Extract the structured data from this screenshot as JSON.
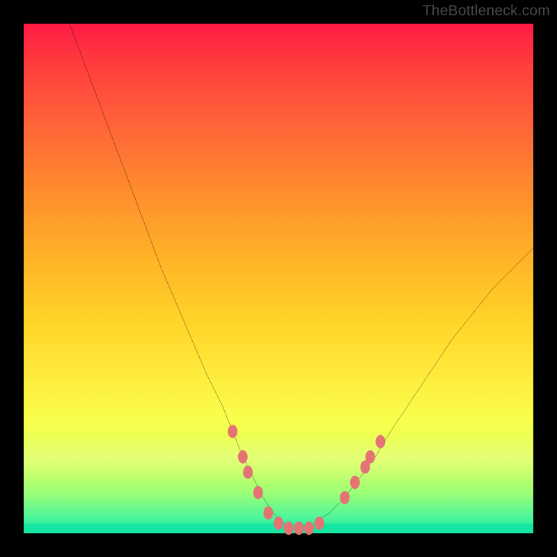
{
  "watermark": "TheBottleneck.com",
  "colors": {
    "frame": "#000000",
    "curve": "#000000",
    "marker": "#e57373",
    "gradient_top": "#ff1a44",
    "gradient_bottom": "#15e6a3"
  },
  "chart_data": {
    "type": "line",
    "title": "",
    "xlabel": "",
    "ylabel": "",
    "xlim": [
      0,
      100
    ],
    "ylim": [
      0,
      100
    ],
    "series": [
      {
        "name": "bottleneck-curve",
        "x": [
          9,
          12,
          15,
          18,
          21,
          24,
          27,
          30,
          33,
          36,
          39,
          41,
          43,
          45,
          47,
          49,
          51,
          53,
          55,
          57,
          60,
          63,
          66,
          69,
          72,
          76,
          80,
          84,
          88,
          92,
          96,
          100
        ],
        "y": [
          100,
          92,
          84,
          76,
          68,
          60,
          52,
          45,
          38,
          31,
          25,
          20,
          15,
          11,
          7,
          4,
          2,
          1,
          1,
          2,
          4,
          7,
          11,
          15,
          20,
          26,
          32,
          38,
          43,
          48,
          52,
          56
        ]
      }
    ],
    "markers": {
      "name": "highlight-points",
      "points": [
        {
          "x": 41,
          "y": 20
        },
        {
          "x": 43,
          "y": 15
        },
        {
          "x": 44,
          "y": 12
        },
        {
          "x": 46,
          "y": 8
        },
        {
          "x": 48,
          "y": 4
        },
        {
          "x": 50,
          "y": 2
        },
        {
          "x": 52,
          "y": 1
        },
        {
          "x": 54,
          "y": 1
        },
        {
          "x": 56,
          "y": 1
        },
        {
          "x": 58,
          "y": 2
        },
        {
          "x": 63,
          "y": 7
        },
        {
          "x": 65,
          "y": 10
        },
        {
          "x": 67,
          "y": 13
        },
        {
          "x": 68,
          "y": 15
        },
        {
          "x": 70,
          "y": 18
        }
      ]
    }
  }
}
